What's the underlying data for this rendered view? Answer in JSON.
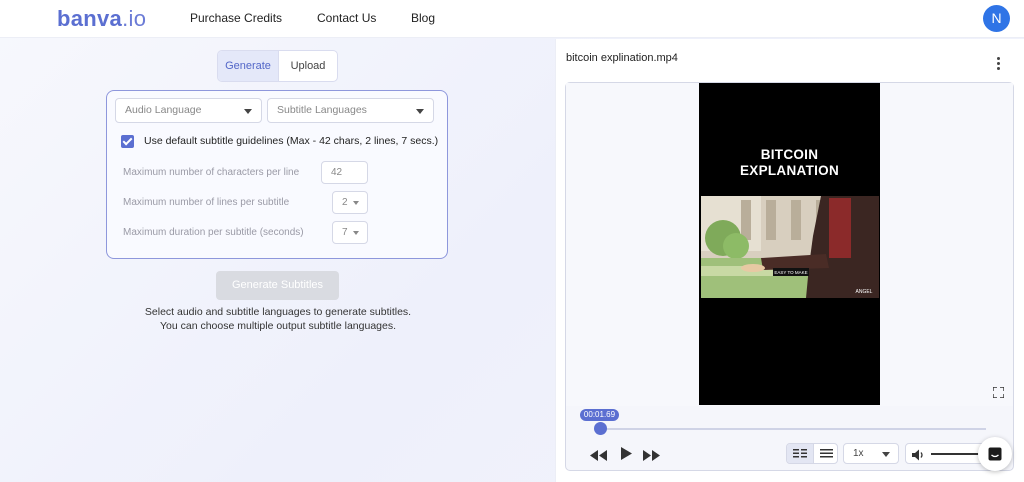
{
  "header": {
    "logo_main": "banva",
    "logo_suffix": ".io",
    "nav": [
      "Purchase Credits",
      "Contact Us",
      "Blog"
    ],
    "avatar_initial": "N"
  },
  "left": {
    "tabs": [
      {
        "label": "Generate",
        "active": true
      },
      {
        "label": "Upload",
        "active": false
      }
    ],
    "audio_language_placeholder": "Audio Language",
    "subtitle_languages_placeholder": "Subtitle Languages",
    "use_default_label": "Use default subtitle guidelines (Max - 42 chars, 2 lines, 7 secs.)",
    "use_default_checked": true,
    "max_chars_label": "Maximum number of characters per line",
    "max_chars_value": "42",
    "max_lines_label": "Maximum number of lines per subtitle",
    "max_lines_value": "2",
    "max_duration_label": "Maximum duration per subtitle (seconds)",
    "max_duration_value": "7",
    "generate_button": "Generate Subtitles",
    "hint_line1": "Select audio and subtitle languages to generate subtitles.",
    "hint_line2": "You can choose multiple output subtitle languages."
  },
  "player": {
    "file_name": "bitcoin explination.mp4",
    "video_title_line1": "BITCOIN",
    "video_title_line2": "EXPLANATION",
    "caption_text": "EASY TO MAKE",
    "watermark": "ANGEL",
    "current_time": "00:01.69",
    "progress_fraction": 0.004,
    "speed": "1x"
  },
  "colors": {
    "accent": "#5b6fd1",
    "avatar": "#2f74e6"
  }
}
